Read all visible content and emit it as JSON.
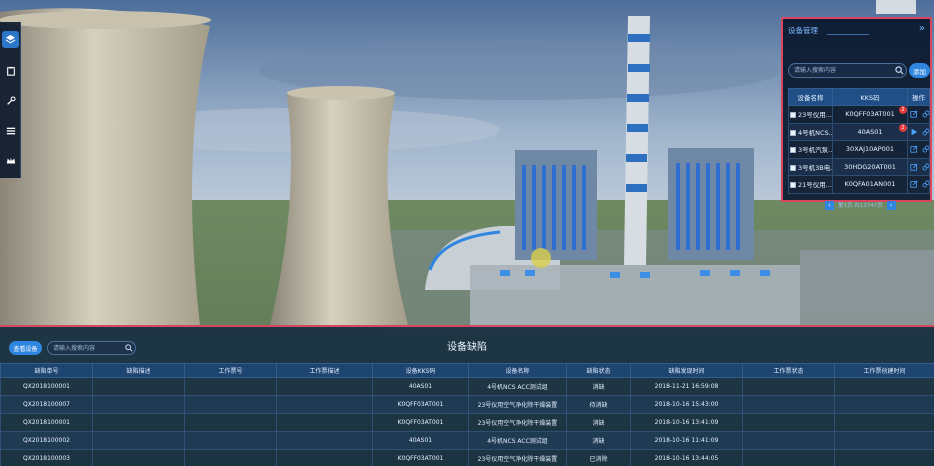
{
  "colors": {
    "accent": "#2f86e0",
    "panel_border": "#d8475f",
    "badge": "#e23a3a",
    "header_bg": "#1f4f86"
  },
  "left_toolbar": {
    "tools": [
      {
        "icon": "layers-icon",
        "active": true
      },
      {
        "icon": "clipboard-icon",
        "active": false
      },
      {
        "icon": "wrench-icon",
        "active": false
      },
      {
        "icon": "list-icon",
        "active": false
      },
      {
        "icon": "crown-icon",
        "active": false
      }
    ]
  },
  "device_panel": {
    "title": "设备管理",
    "search_placeholder": "请输入搜索内容",
    "add_label": "添加",
    "columns": [
      "设备名称",
      "KKS码",
      "操作"
    ],
    "rows": [
      {
        "name": "23号仪用...",
        "kks": "K0QFF03AT001",
        "badge": "2"
      },
      {
        "name": "4号机NCS...",
        "kks": "40AS01",
        "badge": "2"
      },
      {
        "name": "3号机汽泵...",
        "kks": "30XAJ10AP001",
        "badge": ""
      },
      {
        "name": "3号机3B电...",
        "kks": "30HDG20AT001",
        "badge": ""
      },
      {
        "name": "21号仪用...",
        "kks": "K0QFA01AN001",
        "badge": ""
      }
    ],
    "pagination": "第1页 共13747页"
  },
  "defect_panel": {
    "title": "设备缺陷",
    "query_label": "查看设备",
    "search_placeholder": "请输入搜索内容",
    "columns": [
      "缺陷单号",
      "缺陷描述",
      "工作票号",
      "工作票描述",
      "设备KKS码",
      "设备名称",
      "缺陷状态",
      "缺陷发现时间",
      "工作票状态",
      "工作票创建时间"
    ],
    "rows": [
      [
        "QX2018100001",
        "",
        "",
        "",
        "40AS01",
        "4号机NCS ACC测试组",
        "消缺",
        "2018-11-21 16:59:08",
        "",
        ""
      ],
      [
        "QX2018100007",
        "",
        "",
        "",
        "K0QFF03AT001",
        "23号仪用空气净化除干燥装置",
        "待消缺",
        "2018-10-16 15:43:00",
        "",
        ""
      ],
      [
        "QX2018100001",
        "",
        "",
        "",
        "K0QFF03AT001",
        "23号仪用空气净化除干燥装置",
        "消缺",
        "2018-10-16 13:41:09",
        "",
        ""
      ],
      [
        "QX2018100002",
        "",
        "",
        "",
        "40AS01",
        "4号机NCS ACC测试组",
        "消缺",
        "2018-10-16 11:41:09",
        "",
        ""
      ],
      [
        "QX2018100003",
        "",
        "",
        "",
        "K0QFF03AT001",
        "23号仪用空气净化除干燥装置",
        "已消除",
        "2018-10-16 13:44:05",
        "",
        ""
      ]
    ]
  }
}
